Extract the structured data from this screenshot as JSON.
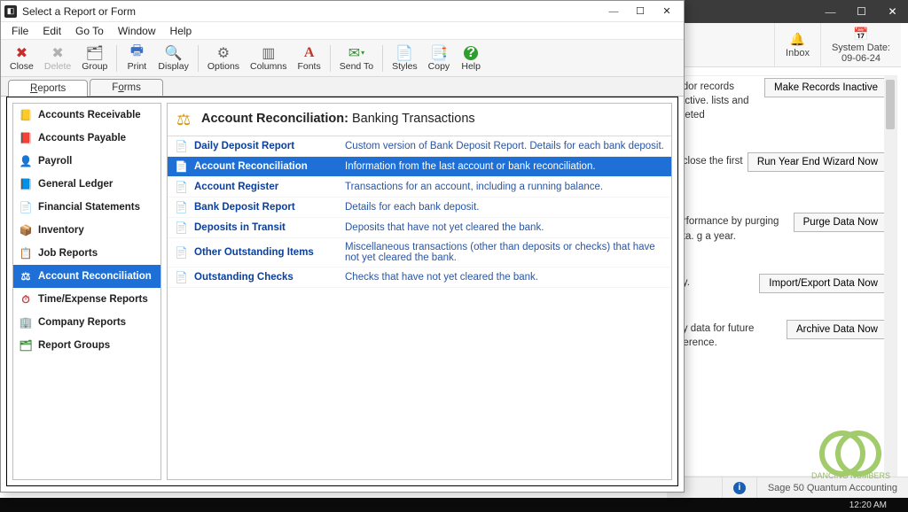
{
  "bg": {
    "inbox_label": "Inbox",
    "system_date_label": "System Date:",
    "system_date_value": "09-06-24",
    "items": [
      {
        "text": "endor records inactive. lists and deleted",
        "button": "Make Records Inactive"
      },
      {
        "text": "to close the first of",
        "button": "Run Year End Wizard Now"
      },
      {
        "text": "performance by purging data. g a year.",
        "button": "Purge Data Now"
      },
      {
        "text": "any.",
        "button": "Import/Export Data Now"
      },
      {
        "text": "any data for future reference.",
        "button": "Archive Data Now"
      }
    ],
    "status_product": "Sage 50 Quantum Accounting",
    "clock": "12:20 AM",
    "watermark": "DANCING NUMBERS"
  },
  "dialog": {
    "title": "Select a Report or Form",
    "menu": [
      "File",
      "Edit",
      "Go To",
      "Window",
      "Help"
    ],
    "toolbar": [
      {
        "label": "Close",
        "icon": "✖",
        "color": "#cc2b2b",
        "disabled": false
      },
      {
        "label": "Delete",
        "icon": "✖",
        "color": "#b0b0b0",
        "disabled": true
      },
      {
        "label": "Group",
        "icon": "🗂",
        "color": "#555",
        "disabled": false
      },
      {
        "sep": true
      },
      {
        "label": "Print",
        "icon": "🖶",
        "color": "#3a6fc4",
        "disabled": false
      },
      {
        "label": "Display",
        "icon": "🔍",
        "color": "#3a6fc4",
        "disabled": false
      },
      {
        "sep": true
      },
      {
        "label": "Options",
        "icon": "⚙",
        "color": "#666",
        "disabled": false
      },
      {
        "label": "Columns",
        "icon": "▥",
        "color": "#666",
        "disabled": false
      },
      {
        "label": "Fonts",
        "icon": "A",
        "color": "#c0392b",
        "disabled": false,
        "font": true
      },
      {
        "sep": true
      },
      {
        "label": "Send To",
        "icon": "✉",
        "color": "#3d8f3d",
        "disabled": false,
        "dropdown": true
      },
      {
        "sep": true
      },
      {
        "label": "Styles",
        "icon": "📄",
        "color": "#666",
        "disabled": false
      },
      {
        "label": "Copy",
        "icon": "📑",
        "color": "#666",
        "disabled": false
      },
      {
        "label": "Help",
        "icon": "?",
        "color": "#2e9e2e",
        "disabled": false,
        "round": true
      }
    ],
    "tabs": [
      {
        "label": "Reports",
        "accel": "R",
        "active": true
      },
      {
        "label": "Forms",
        "accel": "o",
        "active": false
      }
    ],
    "categories": [
      {
        "label": "Accounts Receivable",
        "icon": "📒",
        "color": "#d07a00"
      },
      {
        "label": "Accounts Payable",
        "icon": "📕",
        "color": "#c94f4f"
      },
      {
        "label": "Payroll",
        "icon": "👤",
        "color": "#2f8a2f"
      },
      {
        "label": "General Ledger",
        "icon": "📘",
        "color": "#4a72c7"
      },
      {
        "label": "Financial Statements",
        "icon": "📄",
        "color": "#777"
      },
      {
        "label": "Inventory",
        "icon": "📦",
        "color": "#b58a3e"
      },
      {
        "label": "Job Reports",
        "icon": "📋",
        "color": "#c24040"
      },
      {
        "label": "Account Reconciliation",
        "icon": "⚖",
        "color": "#fff",
        "selected": true
      },
      {
        "label": "Time/Expense Reports",
        "icon": "⏱",
        "color": "#c24040"
      },
      {
        "label": "Company Reports",
        "icon": "🏢",
        "color": "#5a7aa8"
      },
      {
        "label": "Report Groups",
        "icon": "🗂",
        "color": "#3d8f3d"
      }
    ],
    "heading_bold": "Account Reconciliation:",
    "heading_rest": " Banking Transactions",
    "reports": [
      {
        "name": "Daily Deposit Report",
        "desc": "Custom version of Bank Deposit Report.  Details for each bank deposit."
      },
      {
        "name": "Account  Reconciliation",
        "desc": "Information from the last account or bank reconciliation.",
        "selected": true
      },
      {
        "name": "Account  Register",
        "desc": "Transactions for an account, including a running balance."
      },
      {
        "name": "Bank Deposit Report",
        "desc": "Details for each bank deposit."
      },
      {
        "name": "Deposits in Transit",
        "desc": "Deposits that have not yet cleared the bank."
      },
      {
        "name": "Other Outstanding Items",
        "desc": "Miscellaneous transactions (other than deposits or checks) that have not yet cleared the bank."
      },
      {
        "name": "Outstanding Checks",
        "desc": "Checks that have not yet cleared the bank."
      }
    ]
  }
}
